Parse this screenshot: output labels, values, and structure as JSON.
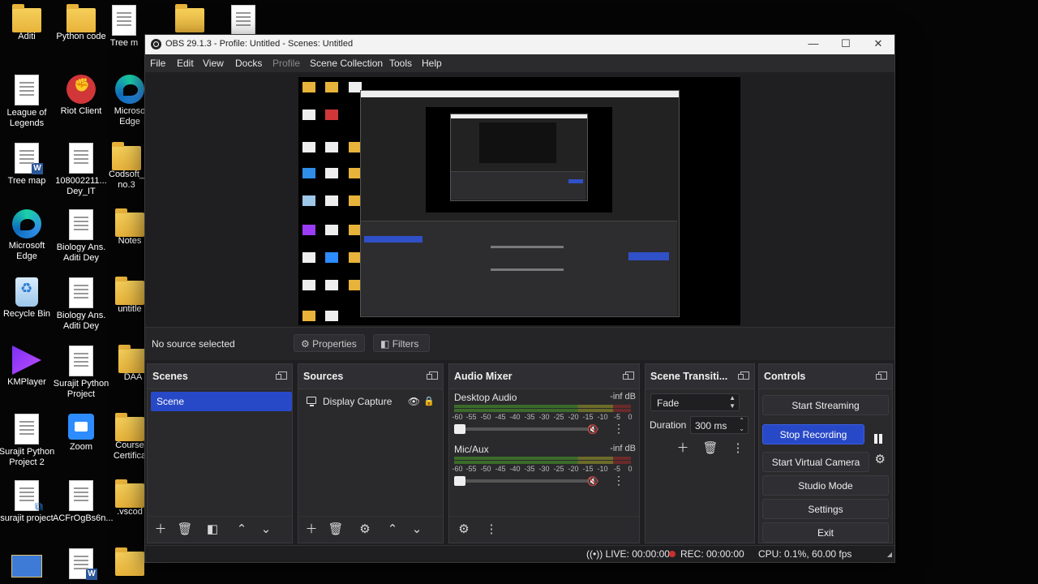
{
  "desktop": {
    "icons": [
      {
        "label": "Aditi"
      },
      {
        "label": "Python code"
      },
      {
        "label": "Tree m"
      },
      {
        "label": "League of Legends"
      },
      {
        "label": "Riot Client"
      },
      {
        "label": "Microso Edge"
      },
      {
        "label": "Tree map"
      },
      {
        "label": "108002211... Dey_IT"
      },
      {
        "label": "Codsoft_ no.3"
      },
      {
        "label": "Microsoft Edge"
      },
      {
        "label": "Biology Ans. Aditi Dey"
      },
      {
        "label": "Notes"
      },
      {
        "label": "Recycle Bin"
      },
      {
        "label": "Biology Ans. Aditi Dey"
      },
      {
        "label": "untitle"
      },
      {
        "label": "KMPlayer"
      },
      {
        "label": "Surajit Python Project"
      },
      {
        "label": "DAA"
      },
      {
        "label": "Surajit Python Project 2"
      },
      {
        "label": "Zoom"
      },
      {
        "label": "Course Certifica"
      },
      {
        "label": "surajit project"
      },
      {
        "label": "ACFrOgBs6n..."
      },
      {
        "label": ".vscod"
      }
    ]
  },
  "window": {
    "title": "OBS 29.1.3 - Profile: Untitled - Scenes: Untitled",
    "controls": {
      "minimize": "—",
      "maximize": "☐",
      "close": "✕"
    }
  },
  "menu": [
    "File",
    "Edit",
    "View",
    "Docks",
    "Profile",
    "Scene Collection",
    "Tools",
    "Help"
  ],
  "source_bar": {
    "status": "No source selected",
    "properties_label": "Properties",
    "filters_label": "Filters"
  },
  "docks": {
    "scenes": {
      "title": "Scenes",
      "items": [
        "Scene"
      ]
    },
    "sources": {
      "title": "Sources",
      "items": [
        "Display Capture"
      ]
    },
    "mixer": {
      "title": "Audio Mixer",
      "channels": [
        {
          "name": "Desktop Audio",
          "level": "-inf dB"
        },
        {
          "name": "Mic/Aux",
          "level": "-inf dB"
        }
      ],
      "scale": [
        "-60",
        "-55",
        "-50",
        "-45",
        "-40",
        "-35",
        "-30",
        "-25",
        "-20",
        "-15",
        "-10",
        "-5",
        "0"
      ]
    },
    "transitions": {
      "title": "Scene Transiti...",
      "selected": "Fade",
      "duration_label": "Duration",
      "duration_value": "300 ms"
    },
    "controls": {
      "title": "Controls",
      "start_streaming": "Start Streaming",
      "stop_recording": "Stop Recording",
      "start_virtual_camera": "Start Virtual Camera",
      "studio_mode": "Studio Mode",
      "settings": "Settings",
      "exit": "Exit"
    }
  },
  "status": {
    "live": "LIVE: 00:00:00",
    "rec": "REC: 00:00:00",
    "cpu": "CPU: 0.1%, 60.00 fps"
  },
  "colors": {
    "accent": "#2849c7",
    "rec": "#c83030"
  }
}
